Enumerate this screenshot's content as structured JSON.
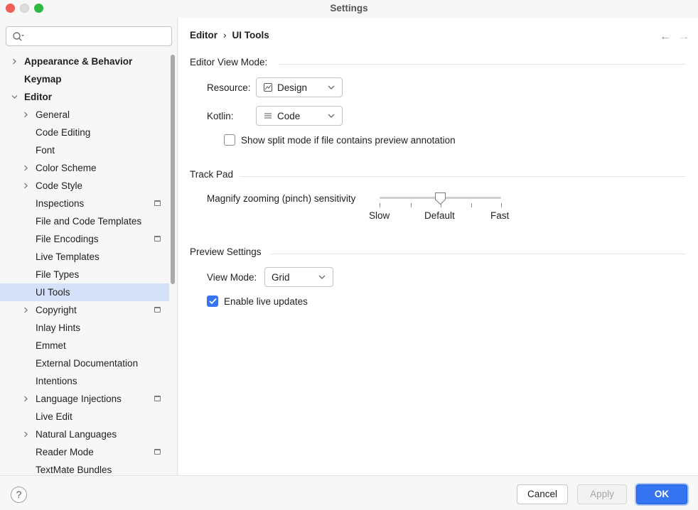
{
  "window": {
    "title": "Settings"
  },
  "sidebar": {
    "search": {
      "placeholder": ""
    },
    "items": [
      {
        "label": "Appearance & Behavior",
        "level": 0,
        "expandable": true,
        "expanded": false,
        "bold": true,
        "marked": false,
        "selected": false
      },
      {
        "label": "Keymap",
        "level": 0,
        "expandable": false,
        "expanded": false,
        "bold": true,
        "marked": false,
        "selected": false
      },
      {
        "label": "Editor",
        "level": 0,
        "expandable": true,
        "expanded": true,
        "bold": true,
        "marked": false,
        "selected": false
      },
      {
        "label": "General",
        "level": 1,
        "expandable": true,
        "expanded": false,
        "bold": false,
        "marked": false,
        "selected": false
      },
      {
        "label": "Code Editing",
        "level": 1,
        "expandable": false,
        "expanded": false,
        "bold": false,
        "marked": false,
        "selected": false
      },
      {
        "label": "Font",
        "level": 1,
        "expandable": false,
        "expanded": false,
        "bold": false,
        "marked": false,
        "selected": false
      },
      {
        "label": "Color Scheme",
        "level": 1,
        "expandable": true,
        "expanded": false,
        "bold": false,
        "marked": false,
        "selected": false
      },
      {
        "label": "Code Style",
        "level": 1,
        "expandable": true,
        "expanded": false,
        "bold": false,
        "marked": false,
        "selected": false
      },
      {
        "label": "Inspections",
        "level": 1,
        "expandable": false,
        "expanded": false,
        "bold": false,
        "marked": true,
        "selected": false
      },
      {
        "label": "File and Code Templates",
        "level": 1,
        "expandable": false,
        "expanded": false,
        "bold": false,
        "marked": false,
        "selected": false
      },
      {
        "label": "File Encodings",
        "level": 1,
        "expandable": false,
        "expanded": false,
        "bold": false,
        "marked": true,
        "selected": false
      },
      {
        "label": "Live Templates",
        "level": 1,
        "expandable": false,
        "expanded": false,
        "bold": false,
        "marked": false,
        "selected": false
      },
      {
        "label": "File Types",
        "level": 1,
        "expandable": false,
        "expanded": false,
        "bold": false,
        "marked": false,
        "selected": false
      },
      {
        "label": "UI Tools",
        "level": 1,
        "expandable": false,
        "expanded": false,
        "bold": false,
        "marked": false,
        "selected": true
      },
      {
        "label": "Copyright",
        "level": 1,
        "expandable": true,
        "expanded": false,
        "bold": false,
        "marked": true,
        "selected": false
      },
      {
        "label": "Inlay Hints",
        "level": 1,
        "expandable": false,
        "expanded": false,
        "bold": false,
        "marked": false,
        "selected": false
      },
      {
        "label": "Emmet",
        "level": 1,
        "expandable": false,
        "expanded": false,
        "bold": false,
        "marked": false,
        "selected": false
      },
      {
        "label": "External Documentation",
        "level": 1,
        "expandable": false,
        "expanded": false,
        "bold": false,
        "marked": false,
        "selected": false
      },
      {
        "label": "Intentions",
        "level": 1,
        "expandable": false,
        "expanded": false,
        "bold": false,
        "marked": false,
        "selected": false
      },
      {
        "label": "Language Injections",
        "level": 1,
        "expandable": true,
        "expanded": false,
        "bold": false,
        "marked": true,
        "selected": false
      },
      {
        "label": "Live Edit",
        "level": 1,
        "expandable": false,
        "expanded": false,
        "bold": false,
        "marked": false,
        "selected": false
      },
      {
        "label": "Natural Languages",
        "level": 1,
        "expandable": true,
        "expanded": false,
        "bold": false,
        "marked": false,
        "selected": false
      },
      {
        "label": "Reader Mode",
        "level": 1,
        "expandable": false,
        "expanded": false,
        "bold": false,
        "marked": true,
        "selected": false
      },
      {
        "label": "TextMate Bundles",
        "level": 1,
        "expandable": false,
        "expanded": false,
        "bold": false,
        "marked": false,
        "selected": false
      }
    ]
  },
  "breadcrumb": {
    "parent": "Editor",
    "separator": "›",
    "current": "UI Tools"
  },
  "nav": {
    "back": "←",
    "forward": "→"
  },
  "editor_view_mode": {
    "title": "Editor View Mode:",
    "resource_label": "Resource:",
    "resource_value": "Design",
    "kotlin_label": "Kotlin:",
    "kotlin_value": "Code",
    "split_mode_label": "Show split mode if file contains preview annotation",
    "split_mode_checked": false
  },
  "track_pad": {
    "title": "Track Pad",
    "sensitivity_label": "Magnify zooming (pinch) sensitivity",
    "labels": [
      "Slow",
      "Default",
      "Fast"
    ],
    "value": 0.5
  },
  "preview_settings": {
    "title": "Preview Settings",
    "view_mode_label": "View Mode:",
    "view_mode_value": "Grid",
    "live_updates_label": "Enable live updates",
    "live_updates_checked": true
  },
  "footer": {
    "help": "?",
    "cancel": "Cancel",
    "apply": "Apply",
    "ok": "OK"
  }
}
